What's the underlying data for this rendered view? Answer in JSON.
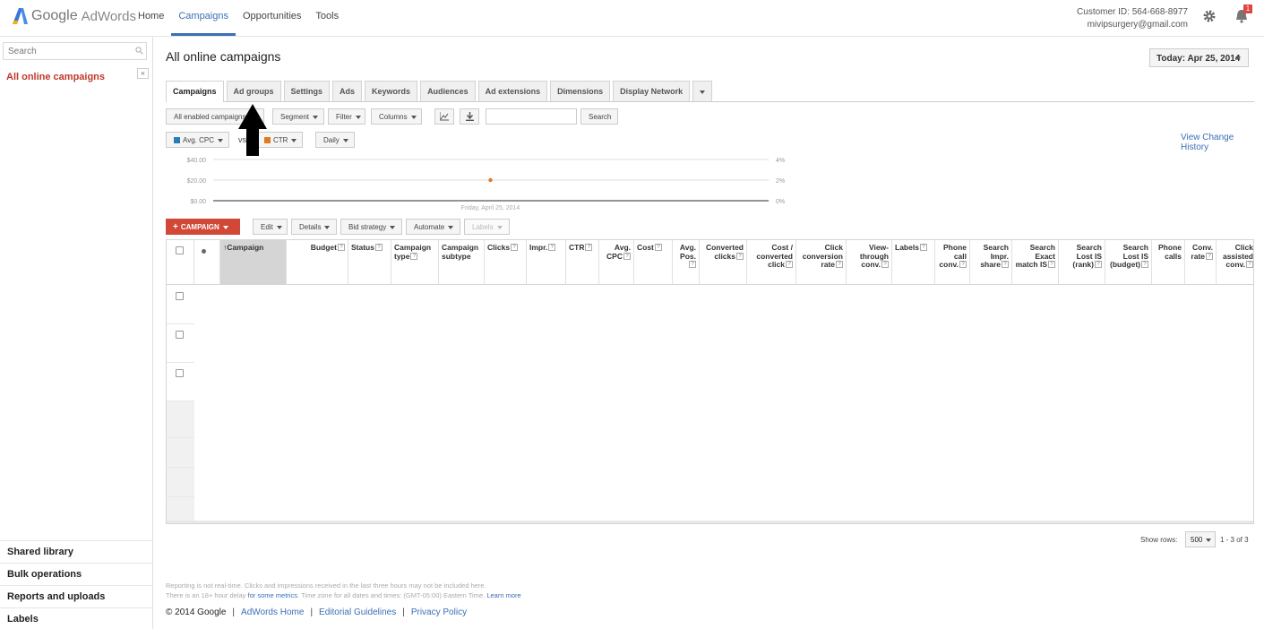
{
  "brand": {
    "google": "Google",
    "adwords": "AdWords"
  },
  "nav": [
    {
      "label": "Home"
    },
    {
      "label": "Campaigns"
    },
    {
      "label": "Opportunities"
    },
    {
      "label": "Tools"
    }
  ],
  "customer": {
    "id_line": "Customer ID: 564-668-8977",
    "email": "mivipsurgery@gmail.com"
  },
  "notifications": {
    "count": "1"
  },
  "sidebar": {
    "search_placeholder": "Search",
    "collapse": "«",
    "all_campaigns": "All online campaigns",
    "bottom": [
      "Shared library",
      "Bulk operations",
      "Reports and uploads",
      "Labels"
    ]
  },
  "page": {
    "title": "All online campaigns",
    "date_range": "Today: Apr 25, 2014",
    "view_change_history": "View Change History"
  },
  "tabs": [
    "Campaigns",
    "Ad groups",
    "Settings",
    "Ads",
    "Keywords",
    "Audiences",
    "Ad extensions",
    "Dimensions",
    "Display Network"
  ],
  "toolbar": {
    "filter_all": "All enabled campaigns",
    "segment": "Segment",
    "filter": "Filter",
    "columns": "Columns",
    "search_button": "Search"
  },
  "chart_controls": {
    "metric1": "Avg. CPC",
    "vs": "vs",
    "metric2": "CTR",
    "period": "Daily",
    "metric1_color": "#2a7db8",
    "metric2_color": "#e07a1f"
  },
  "chart_data": {
    "type": "line",
    "x": [
      "Friday, April 25, 2014"
    ],
    "series": [
      {
        "values": [
          20
        ]
      }
    ],
    "left_ticks": [
      "$40.00",
      "$20.00",
      "$0.00"
    ],
    "right_ticks": [
      "4%",
      "2%",
      "0%"
    ],
    "xlabel": "Friday, April 25, 2014",
    "ylim": [
      0,
      40
    ],
    "y2lim": [
      0,
      4
    ],
    "grid": true
  },
  "actions": {
    "add_campaign": "CAMPAIGN",
    "edit": "Edit",
    "details": "Details",
    "bid_strategy": "Bid strategy",
    "automate": "Automate",
    "labels": "Labels"
  },
  "table": {
    "columns": [
      "Campaign",
      "Budget",
      "Status",
      "Campaign type",
      "Campaign subtype",
      "Clicks",
      "Impr.",
      "CTR",
      "Avg. CPC",
      "Cost",
      "Avg. Pos.",
      "Converted clicks",
      "Cost / converted click",
      "Click conversion rate",
      "View-through conv.",
      "Labels",
      "Phone call conv.",
      "Search Impr. share",
      "Search Exact match IS",
      "Search Lost IS (rank)",
      "Search Lost IS (budget)",
      "Phone calls",
      "Conv. rate",
      "Click assisted conv."
    ],
    "help": "?",
    "row_count": 3
  },
  "pagination": {
    "show_rows_label": "Show rows:",
    "rows_value": "500",
    "range": "1 - 3 of 3"
  },
  "fine_print": {
    "line1": "Reporting is not real-time. Clicks and impressions received in the last three hours may not be included here.",
    "line2_pre": "There is an 18+ hour delay",
    "line2_link": "for some metrics",
    "line2_post": ". Time zone for all dates and times: (GMT-05:00) Eastern Time.",
    "learn_more": "Learn more"
  },
  "footer": {
    "copyright": "© 2014 Google",
    "links": [
      "AdWords Home",
      "Editorial Guidelines",
      "Privacy Policy"
    ],
    "sep": "|"
  }
}
